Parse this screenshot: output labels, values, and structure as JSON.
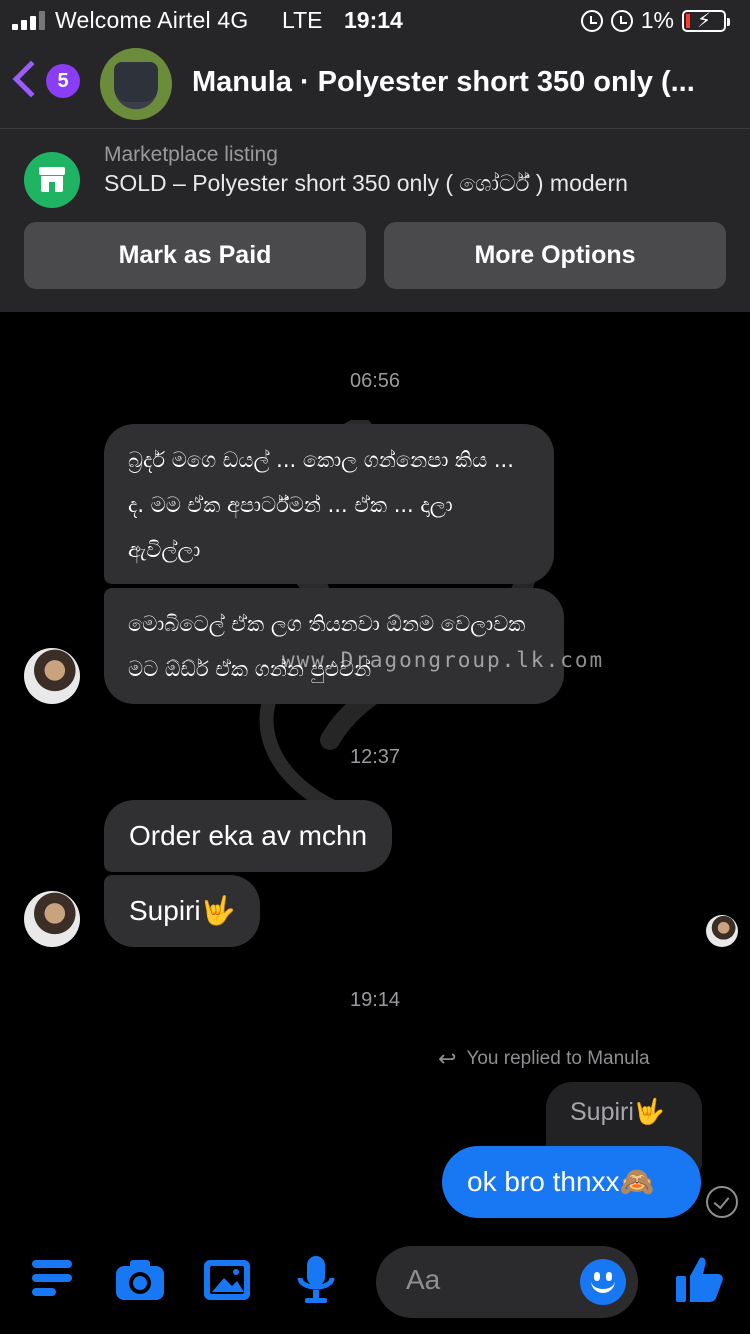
{
  "status_bar": {
    "carrier": "Welcome Airtel 4G",
    "network": "LTE",
    "time": "19:14",
    "battery": "1%"
  },
  "header": {
    "back_count": "5",
    "title": "Manula · Polyester short 350 only (..."
  },
  "listing": {
    "label": "Marketplace listing",
    "title": "SOLD – Polyester short 350 only ( ශෝර්ට් ) modern",
    "mark_paid": "Mark as Paid",
    "more_options": "More Options"
  },
  "messages": {
    "ts1": "06:56",
    "m1": "බ්‍රදර් මගෙ ඩයල් ... කොල ගන්නෙපා කිය ... ද. මම ඒක අපාර්ට්මන් ... ඒක ... දාලා ඇවිල්ලා",
    "m2": "මොබිටෙල් ඒක ලග තියනවා ඕනම වෙලාවක මට ඕඩ්ර් ඒක ගන්න පුළුවන්",
    "ts2": "12:37",
    "m3": "Order eka av   mchn",
    "m4": "Supiri🤟",
    "ts3": "19:14",
    "reply_note": "You replied to Manula",
    "quoted": "Supiri🤟",
    "mine": "ok bro thnxx🙈"
  },
  "watermark": "www.Dragongroup.lk.com",
  "composer": {
    "placeholder": "Aa"
  },
  "icons": [
    "back-chevron-icon",
    "marketplace-store-icon",
    "menu-icon",
    "camera-icon",
    "image-icon",
    "microphone-icon",
    "emoji-icon",
    "like-icon",
    "seen-check-icon",
    "reply-arrow-icon"
  ],
  "colors": {
    "accent": "#1877f2",
    "purple": "#8b3cf5",
    "marketplace": "#1fb463"
  }
}
